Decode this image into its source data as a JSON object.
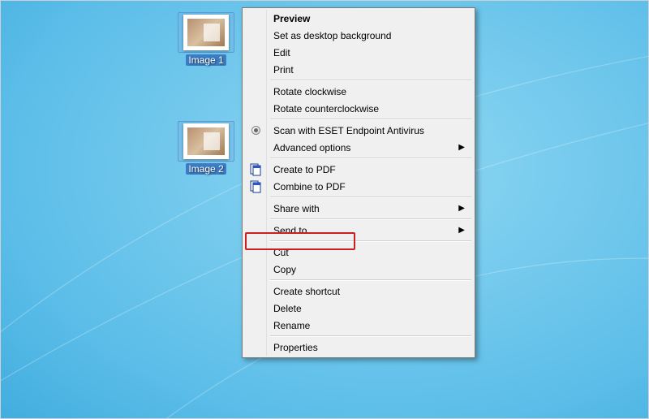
{
  "desktop_icons": [
    {
      "label": "Image 1"
    },
    {
      "label": "Image 2"
    }
  ],
  "menu": {
    "preview": "Preview",
    "set_bg": "Set as desktop background",
    "edit": "Edit",
    "print": "Print",
    "rotate_cw": "Rotate clockwise",
    "rotate_ccw": "Rotate counterclockwise",
    "scan_eset": "Scan with ESET Endpoint Antivirus",
    "adv_options": "Advanced options",
    "create_pdf": "Create to PDF",
    "combine_pdf": "Combine to PDF",
    "share_with": "Share with",
    "send_to": "Send to",
    "cut": "Cut",
    "copy": "Copy",
    "create_shortcut": "Create shortcut",
    "delete": "Delete",
    "rename": "Rename",
    "properties": "Properties"
  }
}
